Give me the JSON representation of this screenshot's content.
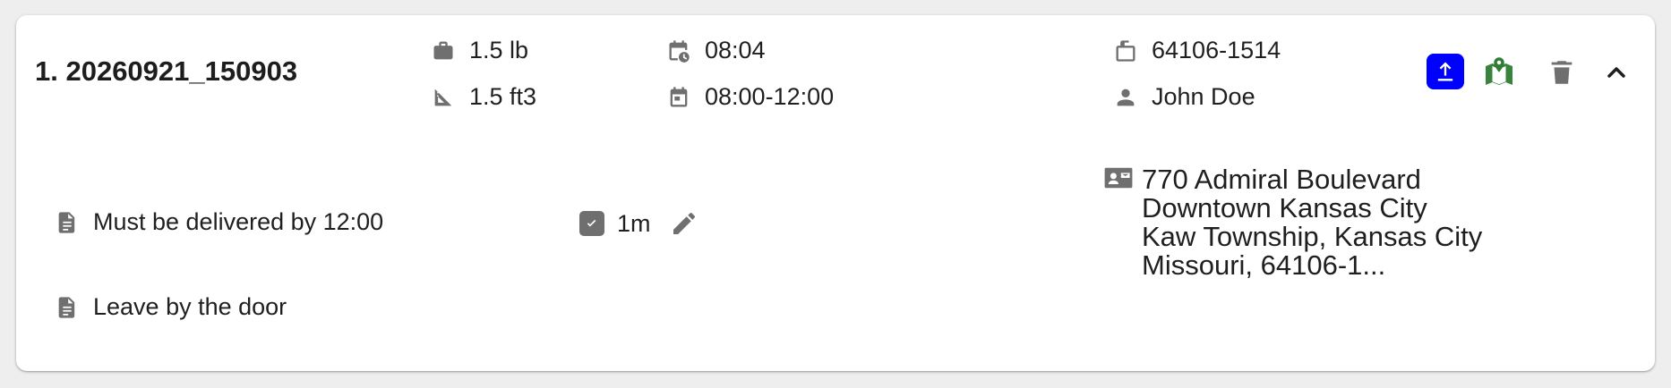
{
  "stop": {
    "title": "1. 20260921_150903",
    "weight": "1.5 lb",
    "volume": "1.5 ft3",
    "eta": "08:04",
    "time_window": "08:00-12:00",
    "postal_code": "64106-1514",
    "recipient": "John Doe"
  },
  "actions": {
    "upload_color": "#0000ff",
    "map_color": "#2e7d32",
    "icon_gray": "#6f6f6f"
  },
  "details": {
    "notes": [
      "Must be delivered by 12:00",
      "Leave by the door"
    ],
    "service_duration": "1m",
    "address_lines": [
      "770 Admiral Boulevard",
      "Downtown Kansas City",
      "Kaw Township, Kansas City",
      "Missouri, 64106-1..."
    ]
  },
  "icons": {
    "weight": "briefcase-icon",
    "volume": "ruler-triangle-icon",
    "eta": "calendar-clock-icon",
    "time_window": "calendar-icon",
    "postal_code": "mailbox-icon",
    "recipient": "person-icon",
    "note": "document-icon",
    "duration": "checked-calendar-icon",
    "edit": "pencil-icon",
    "address": "contact-card-icon",
    "upload": "upload-icon",
    "map": "map-pin-icon",
    "delete": "trash-icon",
    "collapse": "chevron-up-icon"
  }
}
